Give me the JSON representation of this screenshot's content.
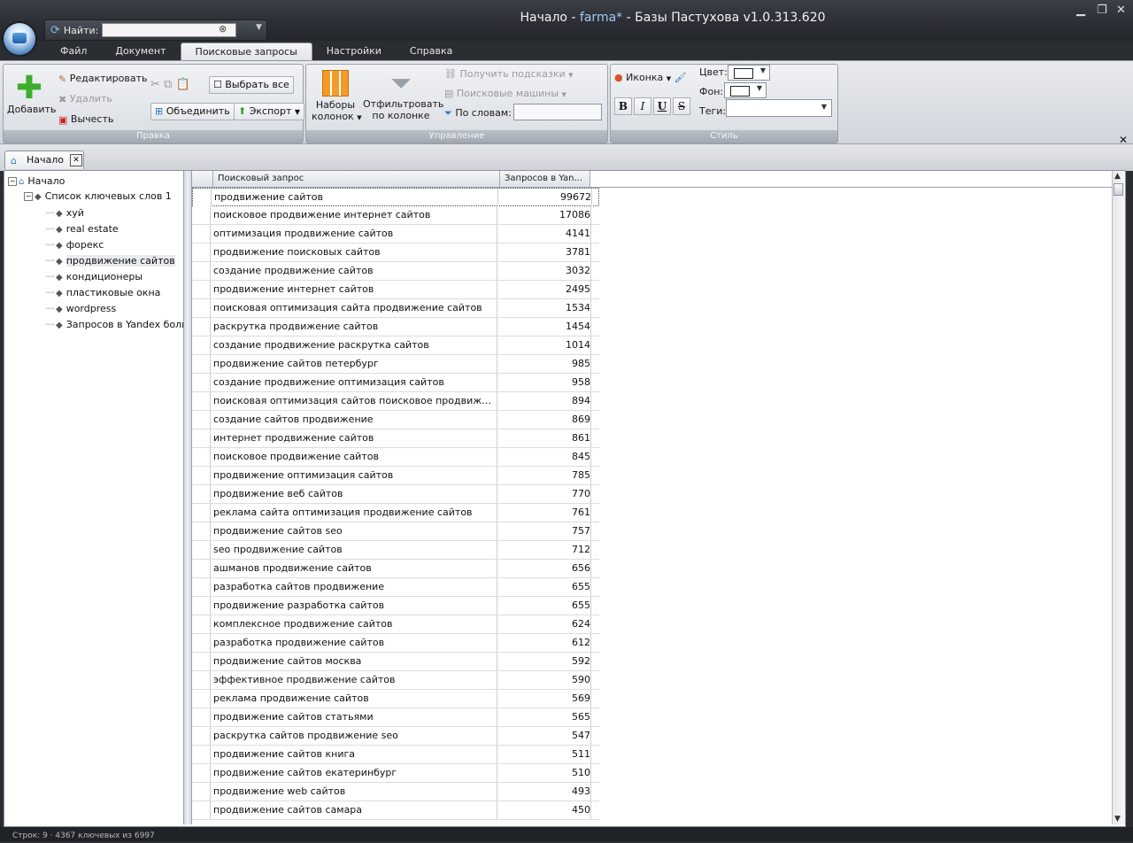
{
  "window": {
    "title_prefix": "Начало - ",
    "title_accent": "farma*",
    "title_suffix": " - Базы Пастухова v1.0.313.620",
    "minimize_icon": "minimize-icon",
    "restore_icon": "restore-icon",
    "close_icon": "close-icon"
  },
  "quick_access": {
    "find_label": "Найти:",
    "search_value": "",
    "search_placeholder": ""
  },
  "menu_tabs": [
    {
      "label": "Файл",
      "active": false
    },
    {
      "label": "Документ",
      "active": false
    },
    {
      "label": "Поисковые запросы",
      "active": true
    },
    {
      "label": "Настройки",
      "active": false
    },
    {
      "label": "Справка",
      "active": false
    }
  ],
  "ribbon": {
    "edit_group": {
      "caption": "Правка",
      "add": "Добавить",
      "edit": "Редактировать",
      "delete": "Удалить",
      "subtract": "Вычесть",
      "select_all": "Выбрать все",
      "merge": "Объединить",
      "export": "Экспорт"
    },
    "manage_group": {
      "caption": "Управление",
      "column_sets_line1": "Наборы",
      "column_sets_line2": "колонок",
      "filter_line1": "Отфильтровать",
      "filter_line2": "по колонке",
      "get_hints": "Получить подсказки",
      "search_engines": "Поисковые машины",
      "by_words": "По словам:",
      "by_words_value": ""
    },
    "style_group": {
      "caption": "Стиль",
      "icon_button": "Иконка",
      "color_label": "Цвет:",
      "background_label": "Фон:",
      "tags_label": "Теги:",
      "tags_value": "",
      "bold": "B",
      "italic": "I",
      "underline": "U",
      "strike": "S"
    }
  },
  "doc_tabs": [
    {
      "label": "Начало"
    }
  ],
  "tree": {
    "root": "Начало",
    "list": "Список ключевых слов 1",
    "items": [
      {
        "label": "хуй"
      },
      {
        "label": "real estate"
      },
      {
        "label": "форекс"
      },
      {
        "label": "продвижение сайтов",
        "selected": true
      },
      {
        "label": "кондиционеры"
      },
      {
        "label": "пластиковые окна"
      },
      {
        "label": "wordpress"
      },
      {
        "label": "Запросов в Yandex боль"
      }
    ]
  },
  "grid": {
    "columns": [
      "Поисковый запрос",
      "Запросов в Yan..."
    ],
    "rows": [
      {
        "query": "продвижение сайтов",
        "count": "99672"
      },
      {
        "query": "поисковое продвижение интернет сайтов",
        "count": "17086"
      },
      {
        "query": "оптимизация продвижение сайтов",
        "count": "4141"
      },
      {
        "query": "продвижение поисковых сайтов",
        "count": "3781"
      },
      {
        "query": "создание продвижение сайтов",
        "count": "3032"
      },
      {
        "query": "продвижение интернет сайтов",
        "count": "2495"
      },
      {
        "query": "поисковая оптимизация сайта продвижение сайтов",
        "count": "1534"
      },
      {
        "query": "раскрутка продвижение сайтов",
        "count": "1454"
      },
      {
        "query": "создание продвижение раскрутка сайтов",
        "count": "1014"
      },
      {
        "query": "продвижение сайтов петербург",
        "count": "985"
      },
      {
        "query": "создание продвижение оптимизация сайтов",
        "count": "958"
      },
      {
        "query": "поисковая оптимизация сайтов поисковое продвижение са...",
        "count": "894"
      },
      {
        "query": "создание сайтов продвижение",
        "count": "869"
      },
      {
        "query": "интернет продвижение сайтов",
        "count": "861"
      },
      {
        "query": "поисковое продвижение сайтов",
        "count": "845"
      },
      {
        "query": "продвижение оптимизация сайтов",
        "count": "785"
      },
      {
        "query": "продвижение веб сайтов",
        "count": "770"
      },
      {
        "query": "реклама сайта оптимизация продвижение сайтов",
        "count": "761"
      },
      {
        "query": "продвижение сайтов seo",
        "count": "757"
      },
      {
        "query": "seo продвижение сайтов",
        "count": "712"
      },
      {
        "query": "ашманов продвижение сайтов",
        "count": "656"
      },
      {
        "query": "разработка сайтов продвижение",
        "count": "655"
      },
      {
        "query": "продвижение разработка сайтов",
        "count": "655"
      },
      {
        "query": "комплексное продвижение сайтов",
        "count": "624"
      },
      {
        "query": "разработка продвижение сайтов",
        "count": "612"
      },
      {
        "query": "продвижение сайтов москва",
        "count": "592"
      },
      {
        "query": "эффективное продвижение сайтов",
        "count": "590"
      },
      {
        "query": "реклама продвижение сайтов",
        "count": "569"
      },
      {
        "query": "продвижение сайтов статьями",
        "count": "565"
      },
      {
        "query": "раскрутка сайтов продвижение seo",
        "count": "547"
      },
      {
        "query": "продвижение сайтов книга",
        "count": "511"
      },
      {
        "query": "продвижение сайтов екатеринбург",
        "count": "510"
      },
      {
        "query": "продвижение web сайтов",
        "count": "493"
      },
      {
        "query": "продвижение сайтов самара",
        "count": "450"
      }
    ]
  },
  "status": {
    "text": "Строк: 9  ·  4367 ключевых из 6997"
  },
  "colors": {
    "chrome_dark": "#2a2d32",
    "ribbon": "#dcdfe4",
    "title_accent": "#a9c8f0"
  }
}
